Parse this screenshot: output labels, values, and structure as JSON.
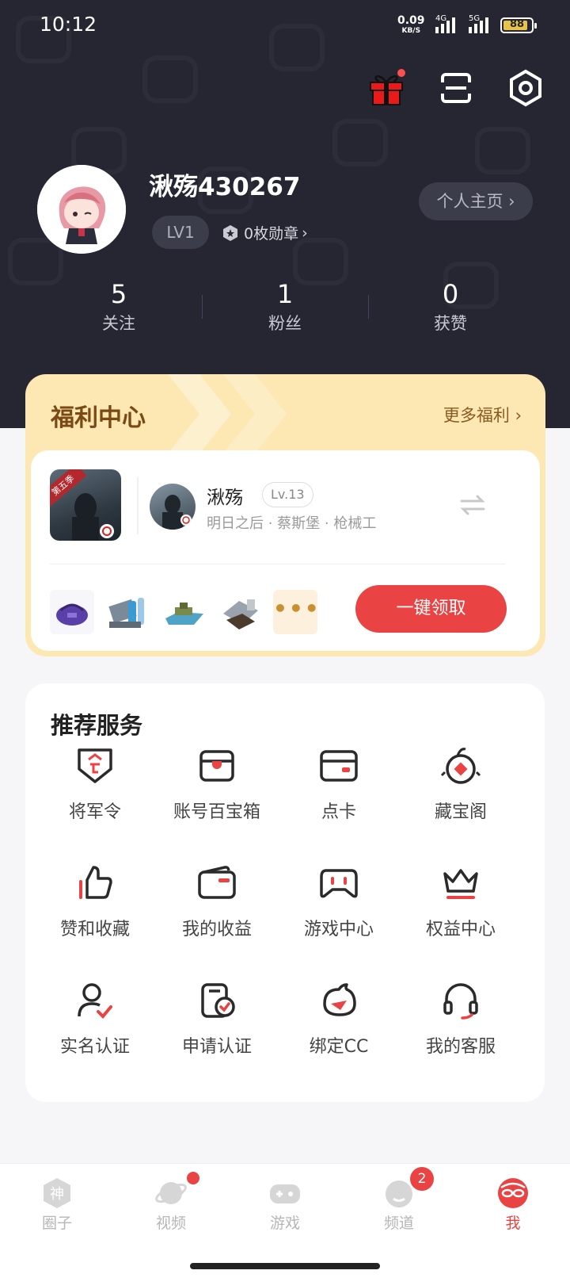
{
  "status_bar": {
    "time": "10:12",
    "net_speed": "0.09",
    "net_unit": "KB/S",
    "signal_1": "4G",
    "signal_2": "5G",
    "battery": "88"
  },
  "header": {
    "icons": [
      "gift-icon",
      "scan-icon",
      "settings-icon"
    ]
  },
  "profile": {
    "username": "湫殇430267",
    "level": "LV1",
    "medals": "0枚勋章",
    "homepage_label": "个人主页"
  },
  "stats": [
    {
      "value": "5",
      "label": "关注"
    },
    {
      "value": "1",
      "label": "粉丝"
    },
    {
      "value": "0",
      "label": "获赞"
    }
  ],
  "welfare": {
    "title": "福利中心",
    "more_label": "更多福利",
    "game_tag": "第五季",
    "character": {
      "name": "湫殇",
      "level": "Lv.13",
      "subtitle": "明日之后 · 蔡斯堡 · 枪械工"
    },
    "more_items": "•••",
    "claim_label": "一键领取"
  },
  "services": {
    "title": "推荐服务",
    "items": [
      {
        "label": "将军令",
        "icon": "shield-icon"
      },
      {
        "label": "账号百宝箱",
        "icon": "treasure-box-icon"
      },
      {
        "label": "点卡",
        "icon": "card-icon"
      },
      {
        "label": "藏宝阁",
        "icon": "treasure-pavilion-icon"
      },
      {
        "label": "赞和收藏",
        "icon": "thumbs-up-icon"
      },
      {
        "label": "我的收益",
        "icon": "wallet-icon"
      },
      {
        "label": "游戏中心",
        "icon": "gamepad-icon"
      },
      {
        "label": "权益中心",
        "icon": "crown-icon"
      },
      {
        "label": "实名认证",
        "icon": "user-verified-icon"
      },
      {
        "label": "申请认证",
        "icon": "document-check-icon"
      },
      {
        "label": "绑定CC",
        "icon": "cc-mascot-icon"
      },
      {
        "label": "我的客服",
        "icon": "headset-icon"
      }
    ]
  },
  "nav": {
    "items": [
      {
        "label": "圈子",
        "icon": "circle-god-icon"
      },
      {
        "label": "视频",
        "icon": "planet-icon"
      },
      {
        "label": "游戏",
        "icon": "gamepad-nav-icon"
      },
      {
        "label": "频道",
        "icon": "channel-icon"
      },
      {
        "label": "我",
        "icon": "me-mask-icon"
      }
    ],
    "channel_badge": "2",
    "active_color": "#ea4343"
  }
}
